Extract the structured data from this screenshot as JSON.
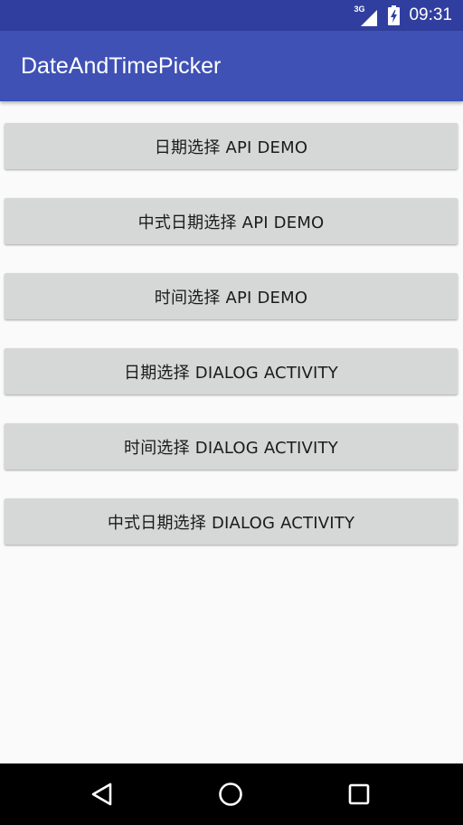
{
  "status_bar": {
    "network": "3G",
    "time": "09:31",
    "icons": [
      "signal-icon",
      "battery-charging-icon"
    ]
  },
  "app_bar": {
    "title": "DateAndTimePicker"
  },
  "buttons": [
    {
      "label": "日期选择 API DEMO"
    },
    {
      "label": "中式日期选择 API DEMO"
    },
    {
      "label": "时间选择 API DEMO"
    },
    {
      "label": "日期选择 DIALOG ACTIVITY"
    },
    {
      "label": "时间选择 DIALOG ACTIVITY"
    },
    {
      "label": "中式日期选择 DIALOG ACTIVITY"
    }
  ],
  "nav_bar": {
    "icons": [
      "back-icon",
      "home-icon",
      "recents-icon"
    ]
  },
  "colors": {
    "status_bar": "#303f9f",
    "app_bar": "#3f51b5",
    "button": "#d6d7d7",
    "background": "#fafafa"
  }
}
